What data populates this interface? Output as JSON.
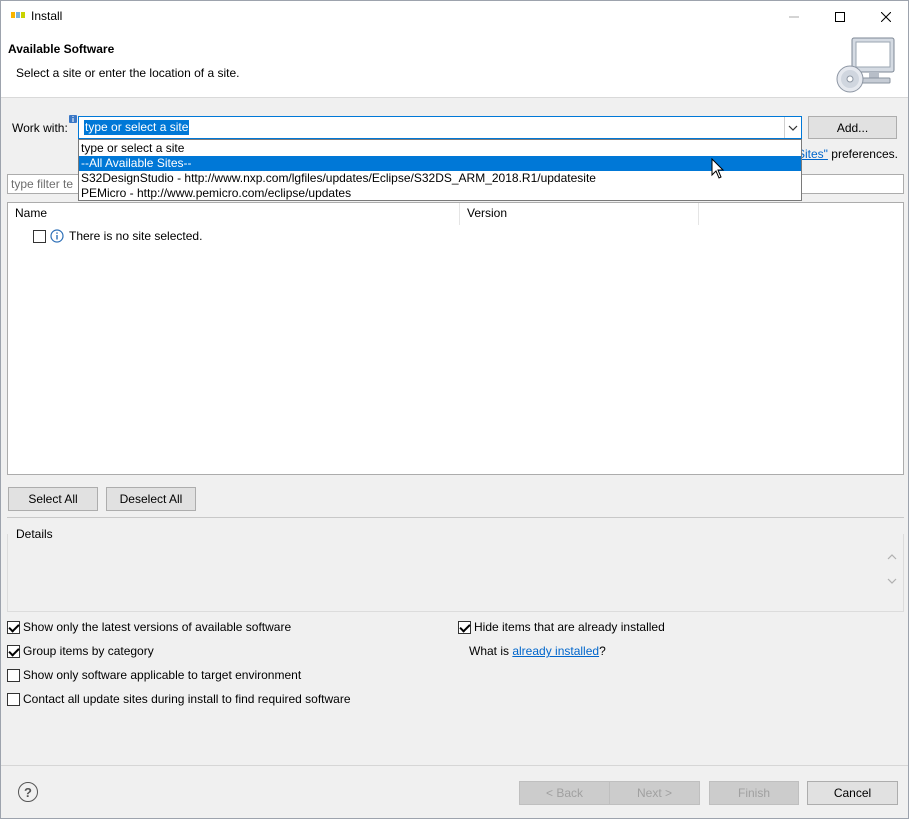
{
  "window": {
    "title": "Install",
    "app_icon": "nxp-logo-icon"
  },
  "banner": {
    "title": "Available Software",
    "subtitle": "Select a site or enter the location of a site.",
    "image_icon": "computer-cd-icon"
  },
  "work_with": {
    "label": "Work with:",
    "value": "type or select a site",
    "add_button": "Add...",
    "preferences_link": "Sites\"",
    "preferences_suffix": " preferences."
  },
  "dropdown": {
    "items": [
      {
        "label": "type or select a site",
        "selected": false
      },
      {
        "label": "--All Available Sites--",
        "selected": true
      },
      {
        "label": "S32DesignStudio - http://www.nxp.com/lgfiles/updates/Eclipse/S32DS_ARM_2018.R1/updatesite",
        "selected": false
      },
      {
        "label": "PEMicro - http://www.pemicro.com/eclipse/updates",
        "selected": false
      }
    ]
  },
  "filter": {
    "placeholder": "type filter te"
  },
  "table": {
    "columns": [
      "Name",
      "Version"
    ],
    "empty_message": "There is no site selected."
  },
  "buttons": {
    "select_all": "Select All",
    "deselect_all": "Deselect All"
  },
  "details": {
    "label": "Details"
  },
  "options": {
    "show_latest": {
      "label": "Show only the latest versions of available software",
      "checked": true
    },
    "group_by_category": {
      "label": "Group items by category",
      "checked": true
    },
    "show_applicable": {
      "label": "Show only software applicable to target environment",
      "checked": false
    },
    "contact_all": {
      "label": "Contact all update sites during install to find required software",
      "checked": false
    },
    "hide_installed": {
      "label": "Hide items that are already installed",
      "checked": true
    },
    "what_is_prefix": "What is ",
    "what_is_link": "already installed",
    "what_is_suffix": "?"
  },
  "footer": {
    "help": "?",
    "back": "< Back",
    "next": "Next >",
    "finish": "Finish",
    "cancel": "Cancel"
  },
  "colors": {
    "accent": "#0078d7",
    "link": "#0066cc",
    "window_bg": "#f0f0f0"
  }
}
